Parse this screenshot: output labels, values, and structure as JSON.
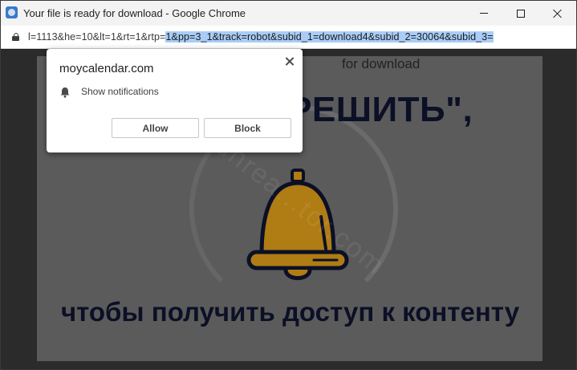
{
  "window": {
    "title": "Your file is ready for download - Google Chrome"
  },
  "addressbar": {
    "url_plain": "l=1113&he=10&lt=1&rt=1&rtp=",
    "url_selected": "1&pp=3_1&track=robot&subid_1=download4&subid_2=30064&subid_3="
  },
  "page": {
    "faint_top_text": "for download",
    "headline": "ЗРЕШИТЬ\",",
    "bottom_text": "чтобы получить доступ к контенту",
    "watermark": "regunrea...tor.com"
  },
  "popup": {
    "domain": "moycalendar.com",
    "permission_label": "Show notifications",
    "allow_label": "Allow",
    "block_label": "Block"
  },
  "colors": {
    "selection": "#a9cdf7",
    "bell": "#b07c14",
    "headline": "#0c1026"
  },
  "icons": [
    "app-icon",
    "minimize-icon",
    "maximize-icon",
    "close-icon",
    "lock-icon",
    "bell-icon",
    "popup-close-icon"
  ]
}
